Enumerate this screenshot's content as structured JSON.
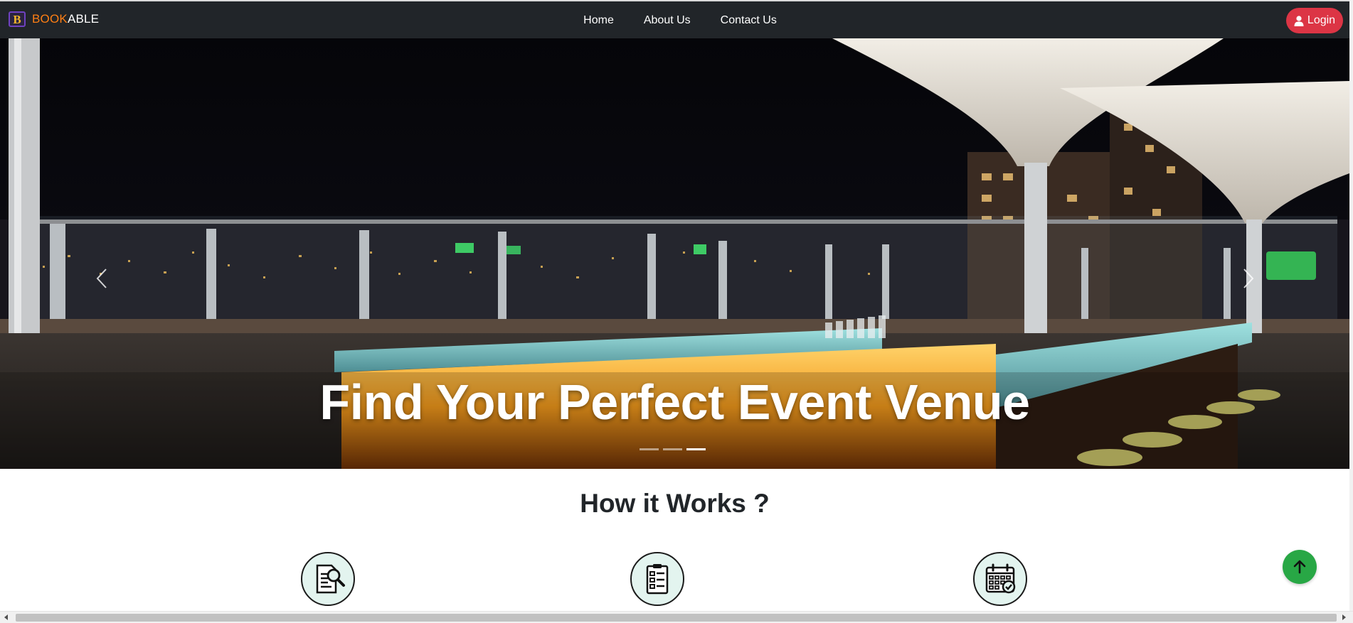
{
  "brand": {
    "logo_letter": "B",
    "name_part1": "BOOK",
    "name_part2": "ABLE"
  },
  "nav": {
    "links": [
      "Home",
      "About Us",
      "Contact Us"
    ],
    "login_label": "Login"
  },
  "hero": {
    "title": "Find Your Perfect Event Venue",
    "slides": 3,
    "active_slide": 3
  },
  "how": {
    "title": "How it Works ?"
  },
  "colors": {
    "navbar": "#212529",
    "brand_accent": "#fd7e14",
    "login": "#dc3545",
    "scroll_top": "#28a745",
    "step_icon_bg": "#e3f4ef"
  },
  "icons": {
    "steps": [
      "document-search-icon",
      "clipboard-checklist-icon",
      "calendar-check-icon"
    ],
    "scroll_top": "arrow-up-icon",
    "login": "user-icon"
  }
}
